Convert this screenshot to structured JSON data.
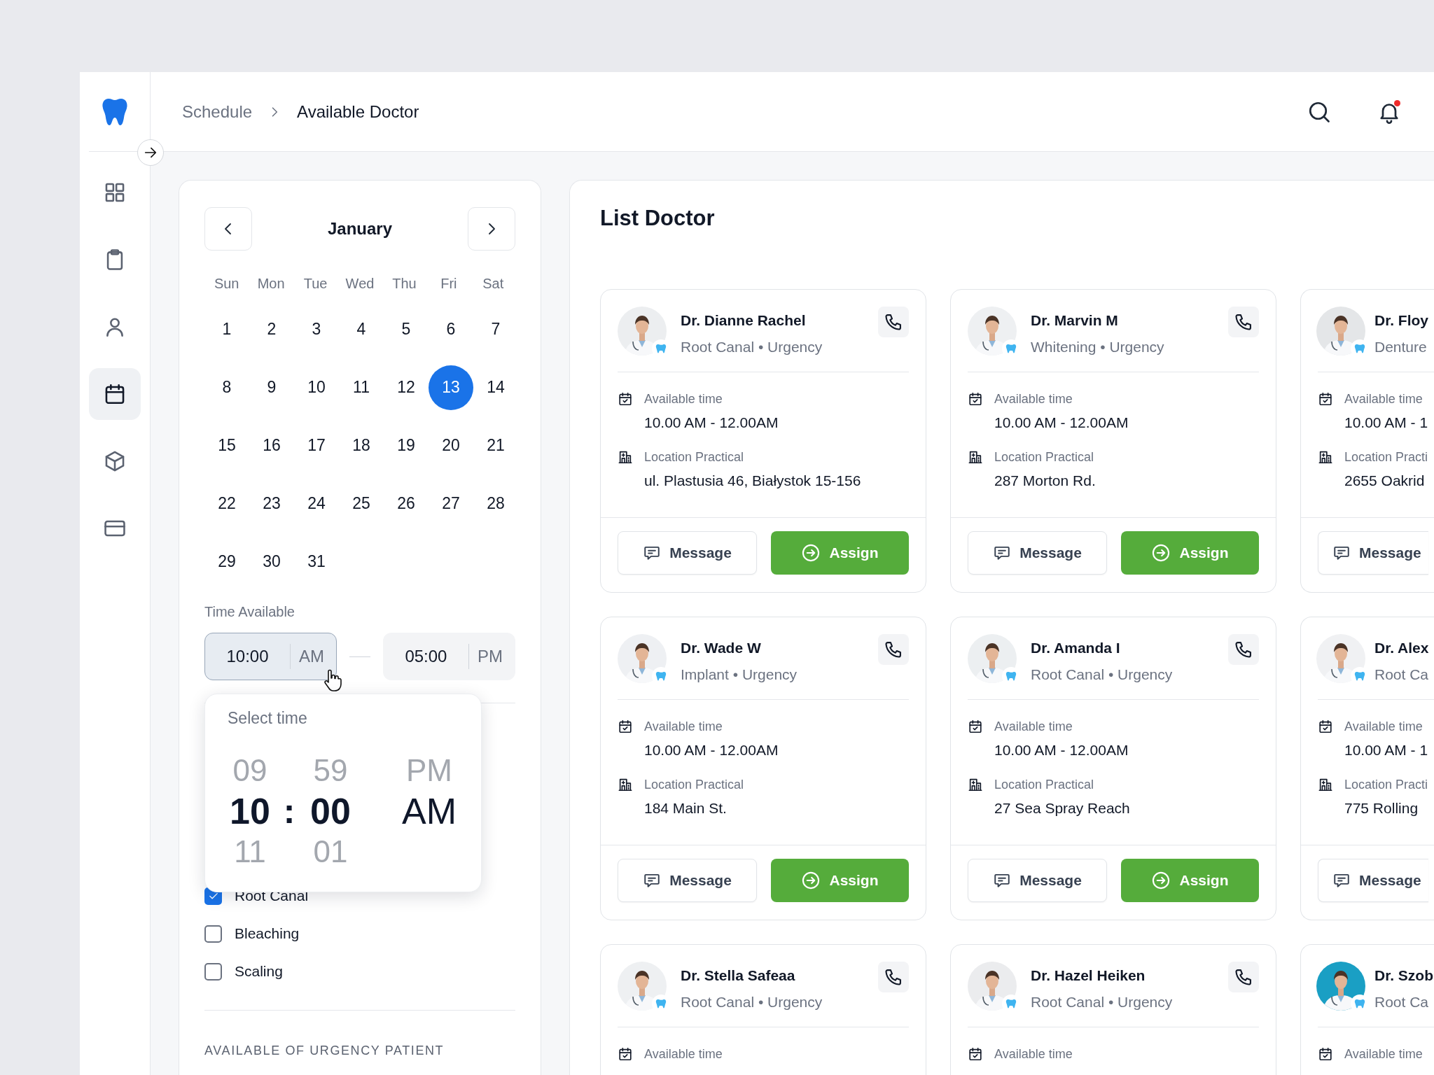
{
  "breadcrumb": [
    {
      "label": "Schedule",
      "current": false
    },
    {
      "label": "Available Doctor",
      "current": true
    }
  ],
  "sidebar": {
    "items": [
      {
        "kind": "grid",
        "selected": false
      },
      {
        "kind": "clipboard",
        "selected": false
      },
      {
        "kind": "person",
        "selected": false
      },
      {
        "kind": "calendar",
        "selected": true
      },
      {
        "kind": "cube",
        "selected": false
      },
      {
        "kind": "card",
        "selected": false
      }
    ]
  },
  "notifications": {
    "unread": true
  },
  "calendar": {
    "month": "January",
    "weekdays": [
      "Sun",
      "Mon",
      "Tue",
      "Wed",
      "Thu",
      "Fri",
      "Sat"
    ],
    "days": [
      {
        "label": "1",
        "selected": false
      },
      {
        "label": "2",
        "selected": false
      },
      {
        "label": "3",
        "selected": false
      },
      {
        "label": "4",
        "selected": false
      },
      {
        "label": "5",
        "selected": false
      },
      {
        "label": "6",
        "selected": false
      },
      {
        "label": "7",
        "selected": false
      },
      {
        "label": "8",
        "selected": false
      },
      {
        "label": "9",
        "selected": false
      },
      {
        "label": "10",
        "selected": false
      },
      {
        "label": "11",
        "selected": false
      },
      {
        "label": "12",
        "selected": false
      },
      {
        "label": "13",
        "selected": true
      },
      {
        "label": "14",
        "selected": false
      },
      {
        "label": "15",
        "selected": false
      },
      {
        "label": "16",
        "selected": false
      },
      {
        "label": "17",
        "selected": false
      },
      {
        "label": "18",
        "selected": false
      },
      {
        "label": "19",
        "selected": false
      },
      {
        "label": "20",
        "selected": false
      },
      {
        "label": "21",
        "selected": false
      },
      {
        "label": "22",
        "selected": false
      },
      {
        "label": "23",
        "selected": false
      },
      {
        "label": "24",
        "selected": false
      },
      {
        "label": "25",
        "selected": false
      },
      {
        "label": "26",
        "selected": false
      },
      {
        "label": "27",
        "selected": false
      },
      {
        "label": "28",
        "selected": false
      },
      {
        "label": "29",
        "selected": false
      },
      {
        "label": "30",
        "selected": false
      },
      {
        "label": "31",
        "selected": false
      }
    ]
  },
  "time_available": {
    "label": "Time Available",
    "start": {
      "time": "10:00",
      "period": "AM",
      "focused": true
    },
    "end": {
      "time": "05:00",
      "period": "PM",
      "focused": false
    }
  },
  "time_picker": {
    "title": "Select time",
    "separator": ":",
    "hours": [
      {
        "label": "09",
        "selected": false
      },
      {
        "label": "10",
        "selected": true
      },
      {
        "label": "11",
        "selected": false
      }
    ],
    "minutes": [
      {
        "label": "59",
        "selected": false
      },
      {
        "label": "00",
        "selected": true
      },
      {
        "label": "01",
        "selected": false
      }
    ],
    "periods": [
      {
        "label": "PM",
        "selected": false
      },
      {
        "label": "AM",
        "selected": true
      }
    ]
  },
  "treatments": [
    {
      "label": "Root Canal",
      "checked": true
    },
    {
      "label": "Bleaching",
      "checked": false
    },
    {
      "label": "Scaling",
      "checked": false
    }
  ],
  "urgency_heading": "AVAILABLE OF URGENCY PATIENT",
  "list": {
    "title": "List Doctor",
    "doctors": [
      {
        "name": "Dr. Dianne Rachel",
        "specialty": "Root Canal • Urgency",
        "available_label": "Available time",
        "available_time": "10.00 AM - 12.00AM",
        "location_label": "Location Practical",
        "location": "ul. Plastusia 46, Białystok 15-156",
        "actions": [
          {
            "kind": "message",
            "label": "Message"
          },
          {
            "kind": "assign",
            "label": "Assign"
          }
        ]
      },
      {
        "name": "Dr. Marvin M",
        "specialty": "Whitening • Urgency",
        "available_label": "Available time",
        "available_time": "10.00 AM - 12.00AM",
        "location_label": "Location Practical",
        "location": "287 Morton Rd.",
        "actions": [
          {
            "kind": "message",
            "label": "Message"
          },
          {
            "kind": "assign",
            "label": "Assign"
          }
        ]
      },
      {
        "name": "Dr. Floy",
        "specialty": "Denture",
        "available_label": "Available time",
        "available_time": "10.00 AM - 1",
        "location_label": "Location Practi",
        "location": "2655 Oakrid",
        "actions": [
          {
            "kind": "message",
            "label": "Message"
          }
        ]
      },
      {
        "name": "Dr. Wade W",
        "specialty": "Implant • Urgency",
        "available_label": "Available time",
        "available_time": "10.00 AM - 12.00AM",
        "location_label": "Location Practical",
        "location": "184 Main St.",
        "actions": [
          {
            "kind": "message",
            "label": "Message"
          },
          {
            "kind": "assign",
            "label": "Assign"
          }
        ]
      },
      {
        "name": "Dr. Amanda I",
        "specialty": "Root Canal • Urgency",
        "available_label": "Available time",
        "available_time": "10.00 AM - 12.00AM",
        "location_label": "Location Practical",
        "location": "27 Sea Spray Reach",
        "actions": [
          {
            "kind": "message",
            "label": "Message"
          },
          {
            "kind": "assign",
            "label": "Assign"
          }
        ]
      },
      {
        "name": "Dr. Alex",
        "specialty": "Root Ca",
        "available_label": "Available time",
        "available_time": "10.00 AM - 1",
        "location_label": "Location Practi",
        "location": "775 Rolling",
        "actions": [
          {
            "kind": "message",
            "label": "Message"
          }
        ]
      },
      {
        "name": "Dr. Stella Safeaa",
        "specialty": "Root Canal • Urgency",
        "available_label": "Available time"
      },
      {
        "name": "Dr. Hazel Heiken",
        "specialty": "Root Canal • Urgency",
        "available_label": "Available time"
      },
      {
        "name": "Dr. Szob",
        "specialty": "Root Ca",
        "available_label": "Available time"
      }
    ]
  }
}
